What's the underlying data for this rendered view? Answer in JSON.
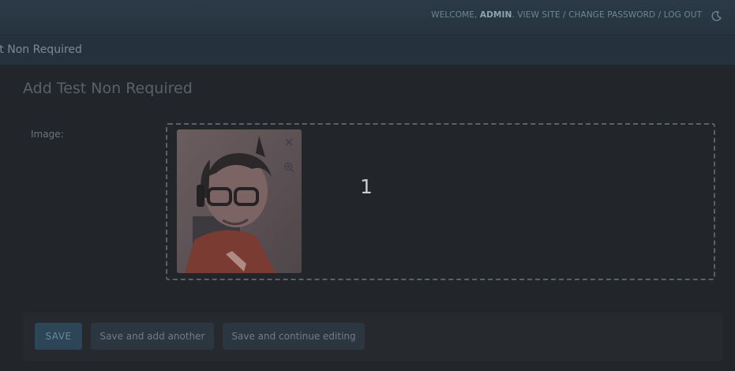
{
  "header": {
    "welcome_prefix": "WELCOME,",
    "username": "ADMIN",
    "welcome_suffix": ".",
    "links": [
      "VIEW SITE",
      "CHANGE PASSWORD",
      "LOG OUT"
    ],
    "separator": " / ",
    "theme_icon": "moon-icon"
  },
  "breadcrumb": {
    "current": "st Non Required"
  },
  "page": {
    "title": "Add Test Non Required"
  },
  "form": {
    "image_label": "Image:",
    "dropzone": {
      "file_count": "1",
      "remove_icon": "close-icon",
      "preview_icon": "zoom-in-icon"
    }
  },
  "submit_row": {
    "save_label": "SAVE",
    "save_add_label": "Save and add another",
    "save_continue_label": "Save and continue editing"
  },
  "colors": {
    "header_bg": "#2b3a46",
    "crumb_bg": "#25323d",
    "page_bg": "#222529",
    "save_bg": "#2c4658"
  }
}
